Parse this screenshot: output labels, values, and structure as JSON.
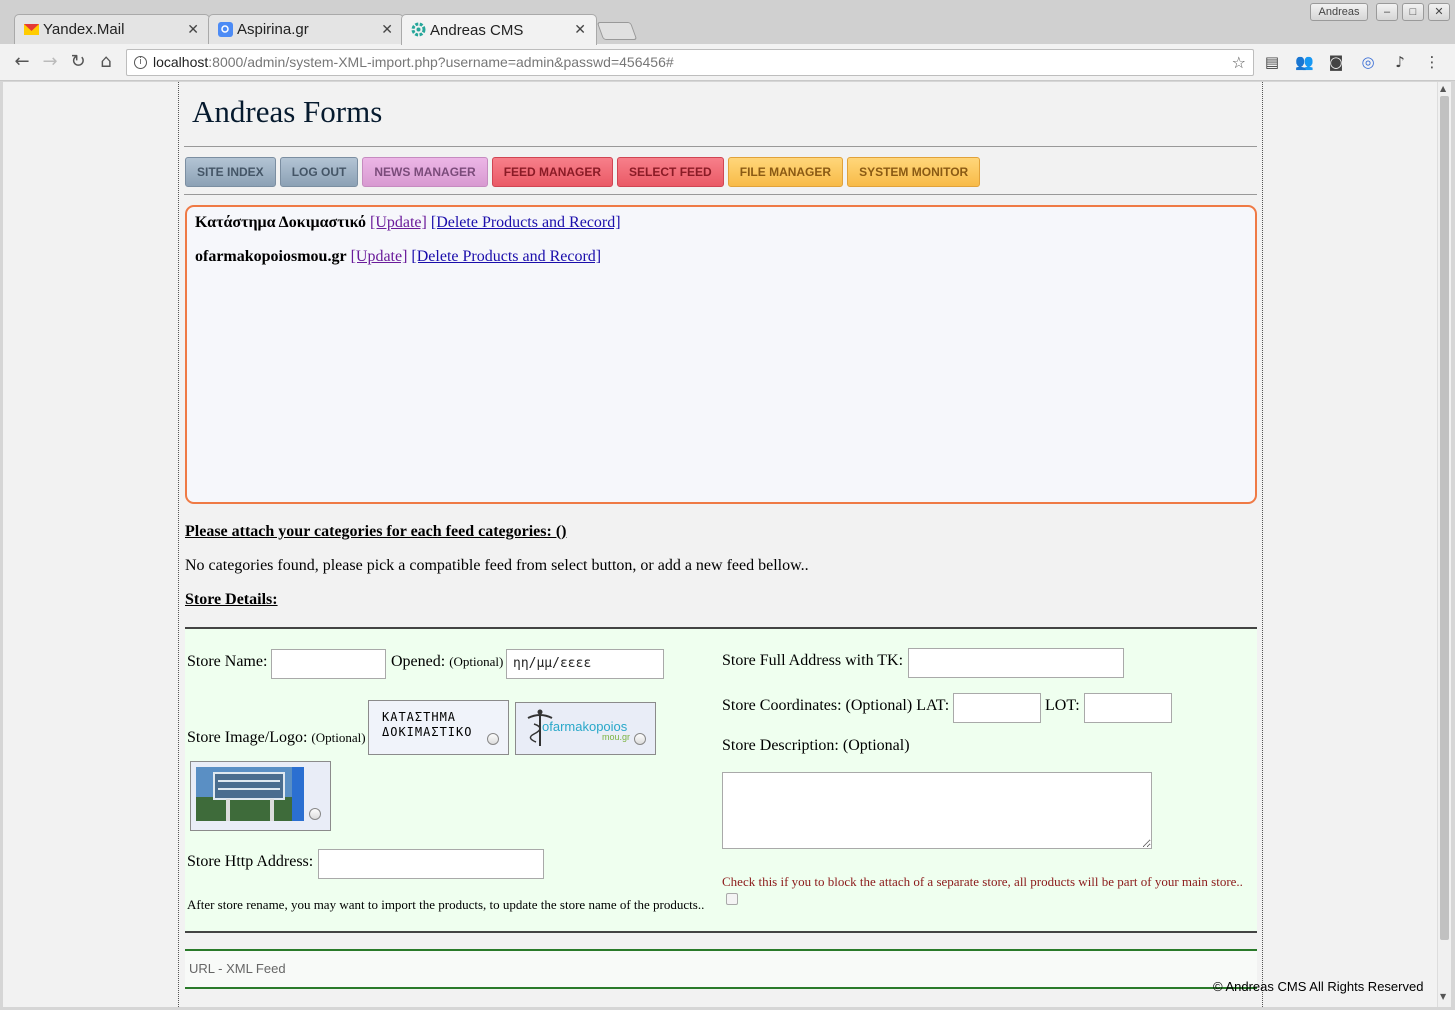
{
  "browser": {
    "tabs": [
      {
        "title": "Yandex.Mail",
        "icon": "yandex-mail-icon"
      },
      {
        "title": "Aspirina.gr",
        "icon": "search-icon"
      },
      {
        "title": "Andreas CMS",
        "icon": "gear-icon"
      }
    ],
    "user_badge": "Andreas",
    "url_host": "localhost",
    "url_rest": ":8000/admin/system-XML-import.php?username=admin&passwd=456456#"
  },
  "page": {
    "title": "Andreas Forms",
    "nav": [
      {
        "label": "SITE INDEX",
        "style": "grey"
      },
      {
        "label": "LOG OUT",
        "style": "grey"
      },
      {
        "label": "NEWS MANAGER",
        "style": "pink"
      },
      {
        "label": "FEED MANAGER",
        "style": "red"
      },
      {
        "label": "SELECT FEED",
        "style": "red"
      },
      {
        "label": "FILE MANAGER",
        "style": "orange"
      },
      {
        "label": "SYSTEM MONITOR",
        "style": "orange"
      }
    ],
    "feeds": [
      {
        "name": "Κατάστημα Δοκιμαστικό",
        "update": "[Update]",
        "delete": "[Delete Products and Record]"
      },
      {
        "name": "ofarmakopoiosmou.gr",
        "update": "[Update]",
        "delete": "[Delete Products and Record]"
      }
    ],
    "categories_heading": "Please attach your categories for each feed categories: ()",
    "categories_message": "No categories found, please pick a compatible feed from select button, or add a new feed bellow..",
    "store_heading": "Store Details:",
    "store": {
      "name_label": "Store Name:",
      "opened_label": "Opened:",
      "opened_optional": "(Optional)",
      "opened_placeholder": "ηη/μμ/εεεε",
      "image_label": "Store Image/Logo:",
      "image_optional": "(Optional)",
      "logo1_text_line1": "ΚΑΤΑΣΤΗΜΑ",
      "logo1_text_line2": "ΔΟΚΙΜΑΣΤΙΚΟ",
      "logo2_text": "ofarmakopoios",
      "logo2_text2": "mou.gr",
      "http_label": "Store Http Address:",
      "rename_note": "After store rename, you may want to import the products, to update the store name of the products..",
      "address_label": "Store Full Address with TK:",
      "coords_label": "Store Coordinates: (Optional) LAT:",
      "lot_label": "LOT:",
      "desc_label": "Store Description: (Optional)",
      "block_note": "Check this if you to block the attach of a separate store, all products will be part of your main store.."
    },
    "url_feed_label": "URL - XML Feed",
    "footer": "© Andreas CMS All Rights Reserved"
  },
  "colors": {
    "feedbox_border": "#ef7a45",
    "store_bg": "#efffef",
    "link": "#1a0dab",
    "warn": "#8b1a1a"
  }
}
